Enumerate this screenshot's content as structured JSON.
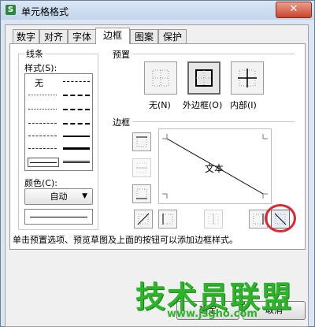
{
  "window": {
    "title": "单元格格式",
    "app_badge": "S",
    "close_glyph": "✕"
  },
  "tabs": [
    {
      "label": "数字"
    },
    {
      "label": "对齐"
    },
    {
      "label": "字体"
    },
    {
      "label": "边框"
    },
    {
      "label": "图案"
    },
    {
      "label": "保护"
    }
  ],
  "active_tab": "边框",
  "line_group": {
    "title": "线条",
    "style_label": "样式(S):",
    "none_label": "无",
    "color_label": "颜色(C):",
    "color_value": "自动"
  },
  "presets": {
    "title": "预置",
    "items": [
      {
        "label": "无(N)"
      },
      {
        "label": "外边框(O)"
      },
      {
        "label": "内部(I)"
      }
    ]
  },
  "border_section": {
    "title": "边框",
    "preview_text": "文本"
  },
  "hint": "单击预置选项、预览草图及上面的按钮可以添加边框样式。",
  "buttons": {
    "ok": "确定",
    "cancel": "取消"
  },
  "watermark": {
    "title": "技术员联盟",
    "url": "www.jsgho.com"
  },
  "colors": {
    "highlight": "#e0262b",
    "watermark": "#2db52a",
    "close": "#c9452d"
  }
}
